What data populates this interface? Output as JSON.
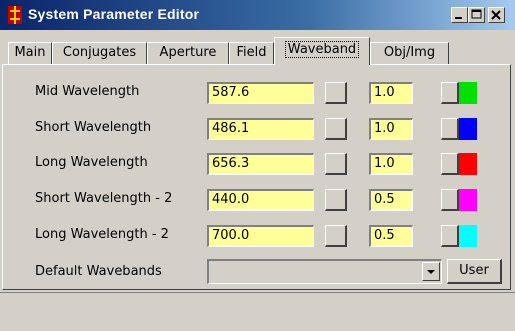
{
  "window": {
    "title": "System Parameter Editor"
  },
  "tabs": [
    {
      "label": "Main"
    },
    {
      "label": "Conjugates"
    },
    {
      "label": "Aperture"
    },
    {
      "label": "Field"
    },
    {
      "label": "Waveband"
    },
    {
      "label": "Obj/Img"
    }
  ],
  "active_tab": "Waveband",
  "wavebands": [
    {
      "label": "Mid Wavelength",
      "value": "587.6",
      "weight": "1.0",
      "color": "#00e000"
    },
    {
      "label": "Short Wavelength",
      "value": "486.1",
      "weight": "1.0",
      "color": "#0000ff"
    },
    {
      "label": "Long Wavelength",
      "value": "656.3",
      "weight": "1.0",
      "color": "#ff0000"
    },
    {
      "label": "Short Wavelength - 2",
      "value": "440.0",
      "weight": "0.5",
      "color": "#ff00ff"
    },
    {
      "label": "Long Wavelength - 2",
      "value": "700.0",
      "weight": "0.5",
      "color": "#00ffff"
    }
  ],
  "default_wavebands": {
    "label": "Default Wavebands",
    "value": "",
    "button": "User"
  },
  "status": {
    "text": ""
  }
}
